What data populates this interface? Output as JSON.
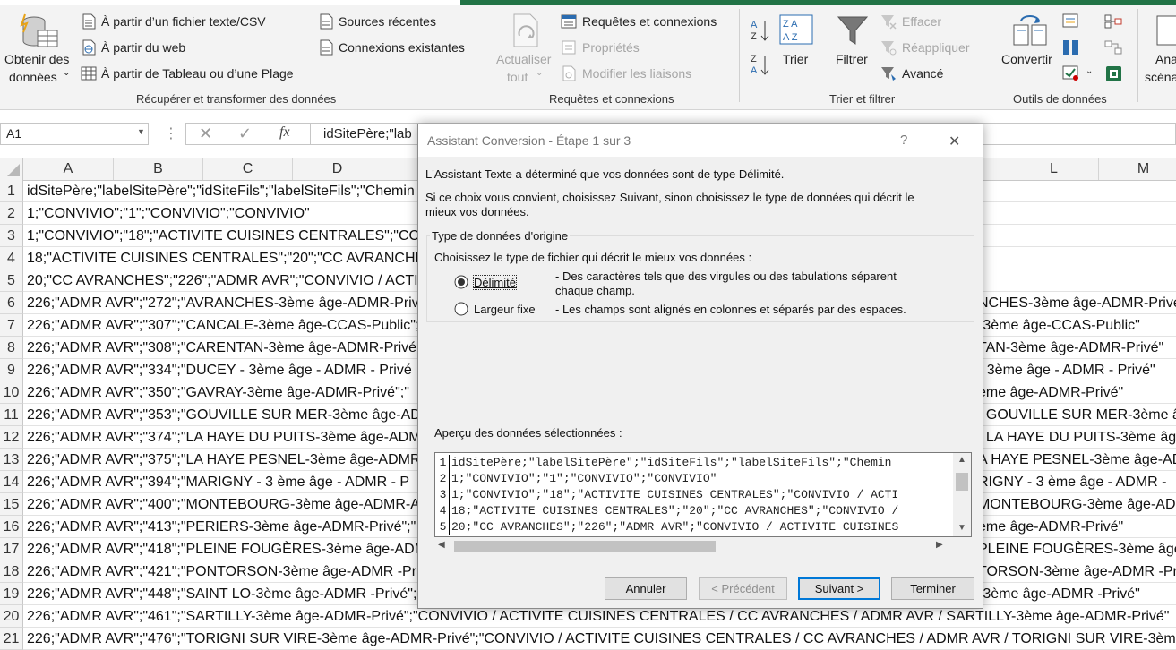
{
  "ribbon": {
    "get_data_label_1": "Obtenir des",
    "get_data_label_2": "données",
    "from_text_csv": "À partir d’un fichier texte/CSV",
    "from_web": "À partir du web",
    "from_table": "À partir de Tableau ou d’une Plage",
    "recent_sources": "Sources récentes",
    "existing_connections": "Connexions existantes",
    "group_get_transform": "Récupérer et transformer des données",
    "refresh_all_1": "Actualiser",
    "refresh_all_2": "tout",
    "queries_connections": "Requêtes et connexions",
    "properties": "Propriétés",
    "edit_links": "Modifier les liaisons",
    "group_queries": "Requêtes et connexions",
    "sort": "Trier",
    "filter": "Filtrer",
    "clear": "Effacer",
    "reapply": "Réappliquer",
    "advanced": "Avancé",
    "group_sort_filter": "Trier et filtrer",
    "convert": "Convertir",
    "group_data_tools": "Outils de données",
    "whatif_1": "Ana",
    "whatif_2": "scéna"
  },
  "formula_bar": {
    "name_box": "A1",
    "fx": "fx",
    "content": "idSitePère;\"lab"
  },
  "columns": [
    "A",
    "B",
    "C",
    "D",
    "L",
    "M"
  ],
  "rows": [
    {
      "n": "1",
      "text": "idSitePère;\"labelSitePère\";\"idSiteFils\";\"labelSiteFils\";\"Chemin",
      "right": ""
    },
    {
      "n": "2",
      "text": "1;\"CONVIVIO\";\"1\";\"CONVIVIO\";\"CONVIVIO\"",
      "right": ""
    },
    {
      "n": "3",
      "text": "1;\"CONVIVIO\";\"18\";\"ACTIVITE CUISINES CENTRALES\";\"CON",
      "right": ""
    },
    {
      "n": "4",
      "text": "18;\"ACTIVITE CUISINES CENTRALES\";\"20\";\"CC AVRANCHES\"",
      "right": ""
    },
    {
      "n": "5",
      "text": "20;\"CC AVRANCHES\";\"226\";\"ADMR AVR\";\"CONVIVIO / ACTI",
      "right": ""
    },
    {
      "n": "6",
      "text": "226;\"ADMR AVR\";\"272\";\"AVRANCHES-3ème âge-ADMR-Priv",
      "right": "NCHES-3ème âge-ADMR-Privé"
    },
    {
      "n": "7",
      "text": "226;\"ADMR AVR\";\"307\";\"CANCALE-3ème âge-CCAS-Public\";",
      "right": "-3ème âge-CCAS-Public\""
    },
    {
      "n": "8",
      "text": "226;\"ADMR AVR\";\"308\";\"CARENTAN-3ème âge-ADMR-Privé",
      "right": "TAN-3ème âge-ADMR-Privé\""
    },
    {
      "n": "9",
      "text": "226;\"ADMR AVR\";\"334\";\"DUCEY - 3ème âge - ADMR   - Privé",
      "right": "- 3ème âge - ADMR   - Privé\""
    },
    {
      "n": "10",
      "text": "226;\"ADMR AVR\";\"350\";\"GAVRAY-3ème âge-ADMR-Privé\";\"",
      "right": "ème âge-ADMR-Privé\""
    },
    {
      "n": "11",
      "text": "226;\"ADMR AVR\";\"353\";\"GOUVILLE SUR MER-3ème âge-AD",
      "right": "/ GOUVILLE SUR MER-3ème â"
    },
    {
      "n": "12",
      "text": "226;\"ADMR AVR\";\"374\";\"LA HAYE DU PUITS-3ème âge-ADM",
      "right": "/ LA HAYE DU PUITS-3ème âg"
    },
    {
      "n": "13",
      "text": "226;\"ADMR AVR\";\"375\";\"LA HAYE PESNEL-3ème âge-ADMR-",
      "right": "A HAYE PESNEL-3ème âge-ADM"
    },
    {
      "n": "14",
      "text": "226;\"ADMR AVR\";\"394\";\"MARIGNY - 3 ème âge - ADMR   - P",
      "right": "RIGNY - 3 ème âge - ADMR   -"
    },
    {
      "n": "15",
      "text": "226;\"ADMR AVR\";\"400\";\"MONTEBOURG-3ème âge-ADMR-A",
      "right": "MONTEBOURG-3ème âge-ADM"
    },
    {
      "n": "16",
      "text": "226;\"ADMR AVR\";\"413\";\"PERIERS-3ème âge-ADMR-Privé\";\"",
      "right": "ème âge-ADMR-Privé\""
    },
    {
      "n": "17",
      "text": "226;\"ADMR AVR\";\"418\";\"PLEINE FOUGÈRES-3ème âge-ADM",
      "right": "PLEINE FOUGÈRES-3ème âge-"
    },
    {
      "n": "18",
      "text": "226;\"ADMR AVR\";\"421\";\"PONTORSON-3ème âge-ADMR -Pri",
      "right": "TORSON-3ème âge-ADMR -Pr"
    },
    {
      "n": "19",
      "text": "226;\"ADMR AVR\";\"448\";\"SAINT LO-3ème âge-ADMR -Privé\";",
      "right": "-3ème âge-ADMR -Privé\""
    },
    {
      "n": "20",
      "text": "226;\"ADMR AVR\";\"461\";\"SARTILLY-3ème âge-ADMR-Privé\";\"CONVIVIO / ACTIVITE CUISINES CENTRALES / CC AVRANCHES / ADMR AVR / SARTILLY-3ème âge-ADMR-Privé\"",
      "right": ""
    },
    {
      "n": "21",
      "text": "226;\"ADMR AVR\";\"476\";\"TORIGNI SUR VIRE-3ème âge-ADMR-Privé\";\"CONVIVIO / ACTIVITE CUISINES CENTRALES / CC AVRANCHES / ADMR AVR / TORIGNI SUR VIRE-3ème âge",
      "right": ""
    }
  ],
  "dialog": {
    "title": "Assistant Conversion - Étape 1 sur 3",
    "help": "?",
    "close": "✕",
    "intro_1": "L'Assistant Texte a déterminé que vos données sont de type Délimité.",
    "intro_2": "Si ce choix vous convient, choisissez Suivant, sinon choisissez le type de données qui décrit le",
    "intro_3": "mieux vos données.",
    "group_title": "Type de données d'origine",
    "choose_label": "Choisissez le type de fichier qui décrit le mieux vos données :",
    "delimited_label": "Délimité",
    "delimited_desc_1": "- Des caractères tels que des virgules ou des tabulations séparent",
    "delimited_desc_2": "chaque champ.",
    "fixed_label": "Largeur fixe",
    "fixed_desc": "- Les champs sont alignés en colonnes et séparés par des espaces.",
    "preview_label": "Aperçu des données sélectionnées :",
    "preview_rows": [
      {
        "n": "1",
        "text": "idSitePère;\"labelSitePère\";\"idSiteFils\";\"labelSiteFils\";\"Chemin"
      },
      {
        "n": "2",
        "text": "1;\"CONVIVIO\";\"1\";\"CONVIVIO\";\"CONVIVIO\""
      },
      {
        "n": "3",
        "text": "1;\"CONVIVIO\";\"18\";\"ACTIVITE CUISINES CENTRALES\";\"CONVIVIO / ACTI"
      },
      {
        "n": "4",
        "text": "18;\"ACTIVITE CUISINES CENTRALES\";\"20\";\"CC AVRANCHES\";\"CONVIVIO /"
      },
      {
        "n": "5",
        "text": "20;\"CC AVRANCHES\";\"226\";\"ADMR AVR\";\"CONVIVIO / ACTIVITE CUISINES"
      }
    ],
    "btn_cancel": "Annuler",
    "btn_prev": "< Précédent",
    "btn_next": "Suivant >",
    "btn_finish": "Terminer"
  }
}
